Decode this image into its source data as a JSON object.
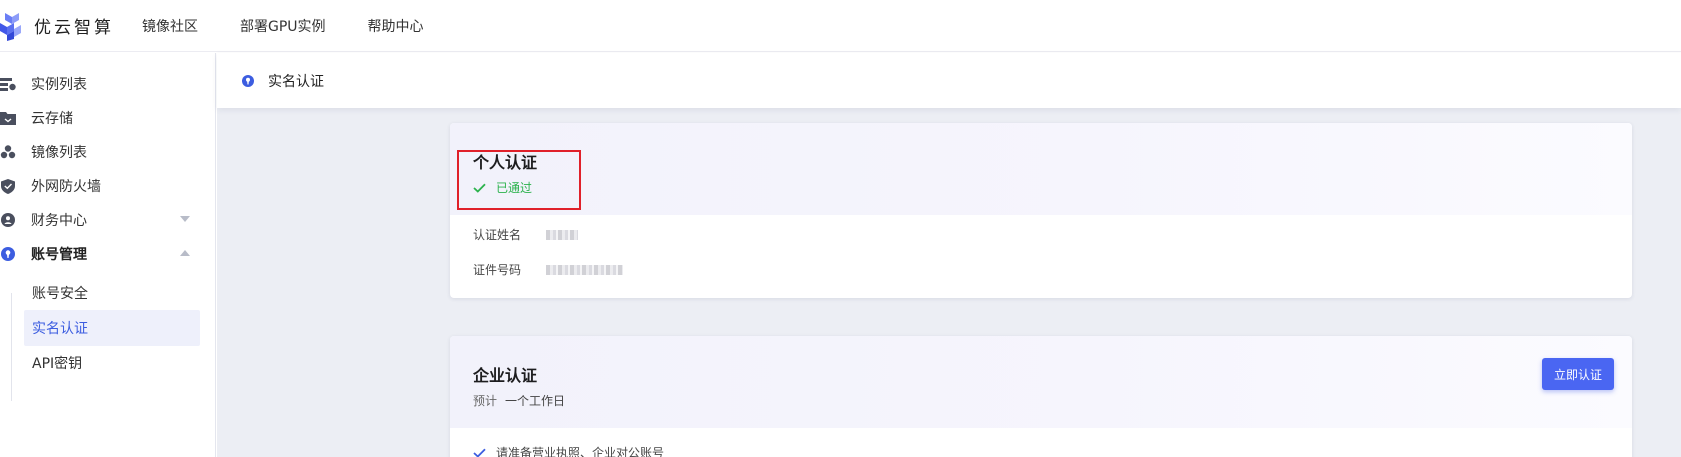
{
  "brand": {
    "name": "优云智算"
  },
  "topnav": {
    "items": [
      {
        "label": "镜像社区"
      },
      {
        "label": "部署GPU实例"
      },
      {
        "label": "帮助中心"
      }
    ]
  },
  "sidebar": {
    "items": [
      {
        "label": "实例列表",
        "icon": "instance-list-icon"
      },
      {
        "label": "云存储",
        "icon": "folder-icon"
      },
      {
        "label": "镜像列表",
        "icon": "cubes-icon"
      },
      {
        "label": "外网防火墙",
        "icon": "shield-icon"
      },
      {
        "label": "财务中心",
        "icon": "finance-icon"
      },
      {
        "label": "账号管理",
        "icon": "account-icon"
      }
    ],
    "subitems": [
      {
        "label": "账号安全"
      },
      {
        "label": "实名认证"
      },
      {
        "label": "API密钥"
      }
    ]
  },
  "page": {
    "title": "实名认证"
  },
  "personal": {
    "title": "个人认证",
    "status": "已通过",
    "fields": [
      {
        "key": "认证姓名"
      },
      {
        "key": "证件号码"
      }
    ]
  },
  "enterprise": {
    "title": "企业认证",
    "estimate_label": "预计",
    "estimate_value": "一个工作日",
    "button": "立即认证",
    "requirement": "请准备营业执照、企业对公账号"
  },
  "colors": {
    "accent": "#4a66f2",
    "success": "#2bb24c",
    "highlight": "#e0202a"
  }
}
